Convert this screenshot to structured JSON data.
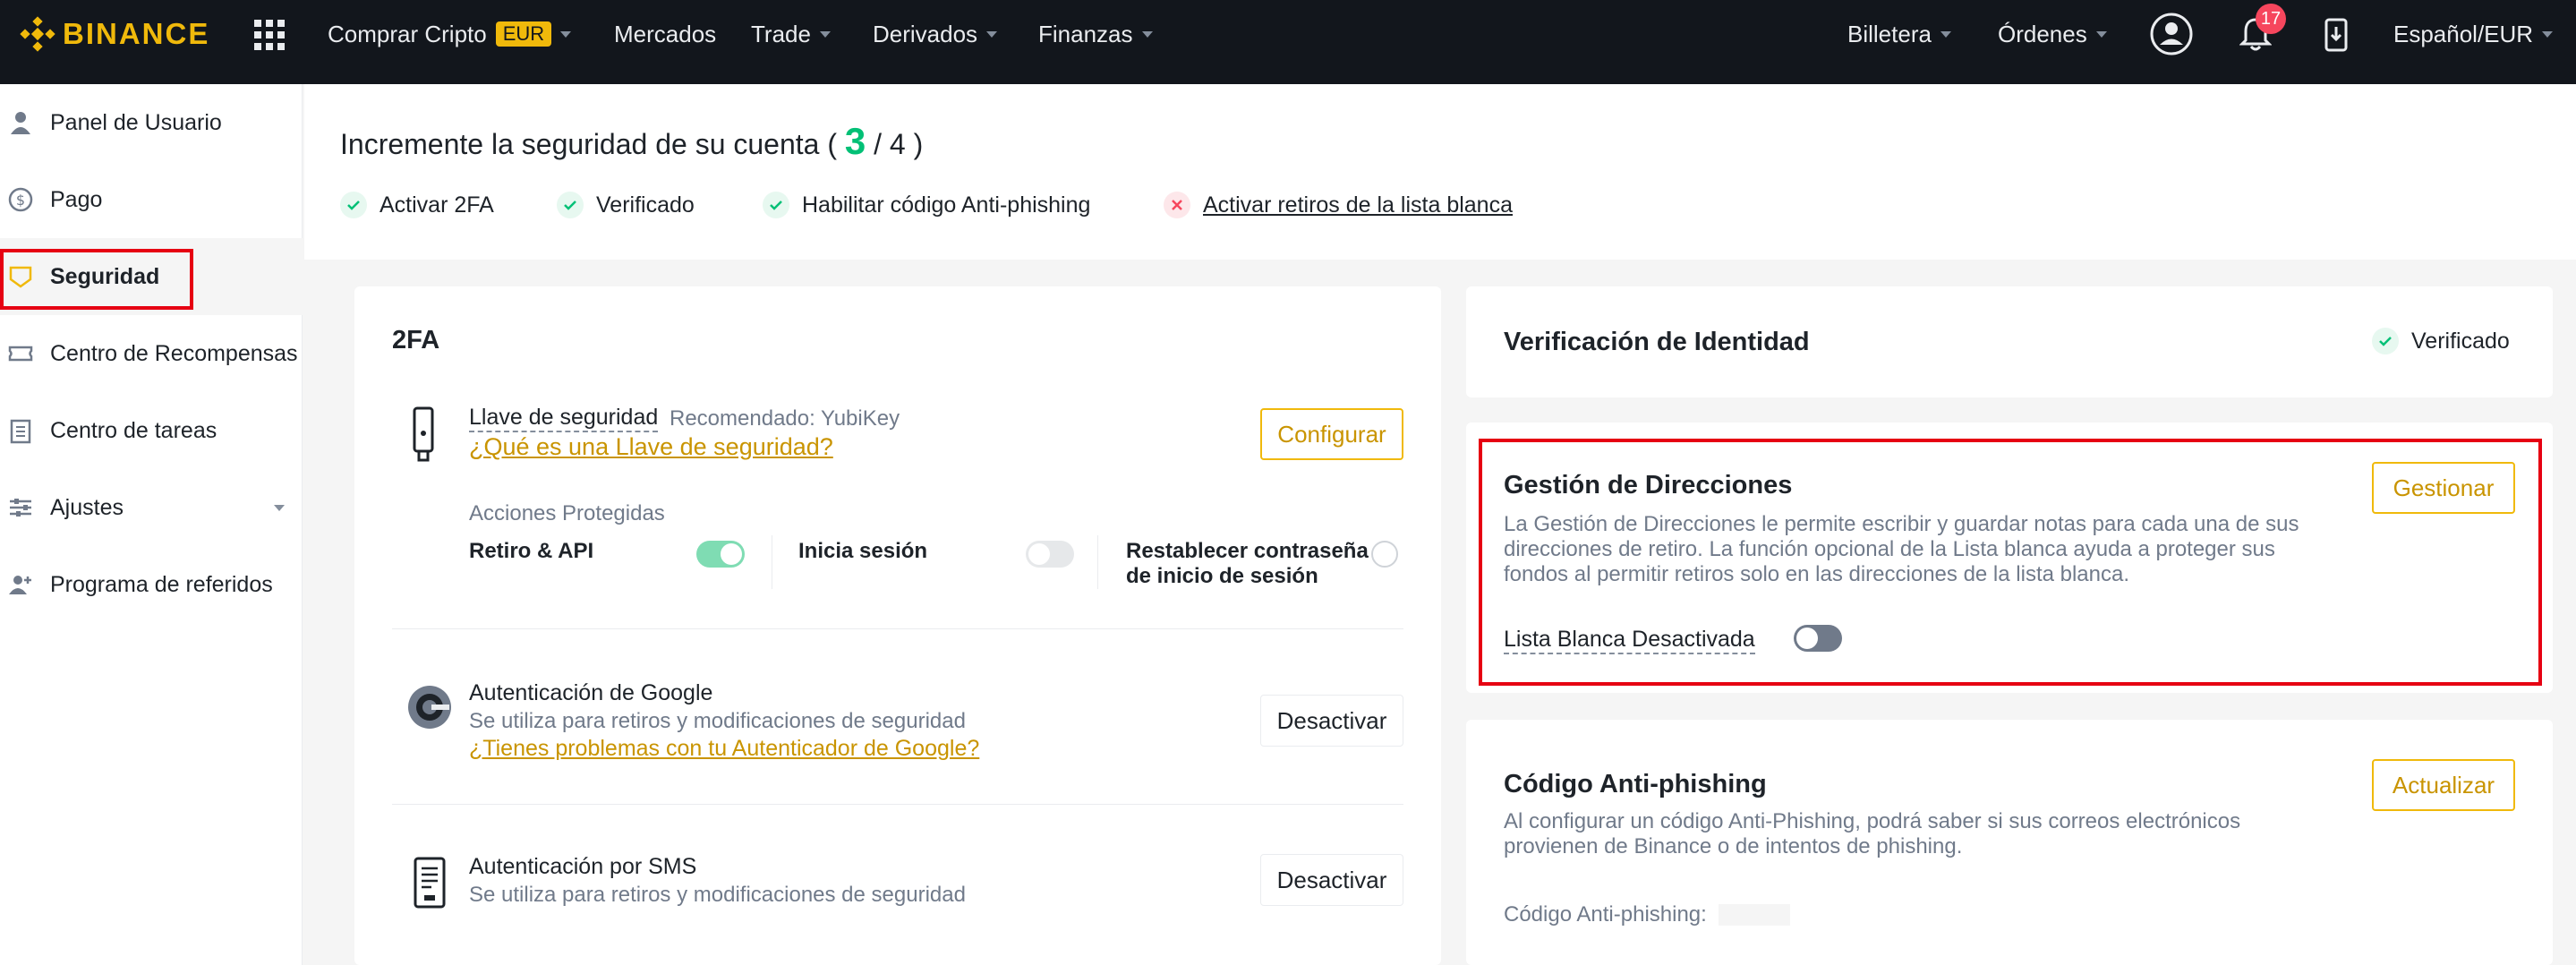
{
  "brand": {
    "name": "BINANCE",
    "color": "#f0b90b"
  },
  "topnav": {
    "items": [
      {
        "label": "Comprar Cripto",
        "badge": "EUR"
      },
      {
        "label": "Mercados"
      },
      {
        "label": "Trade"
      },
      {
        "label": "Derivados"
      },
      {
        "label": "Finanzas"
      }
    ],
    "right": {
      "wallet": "Billetera",
      "orders": "Órdenes",
      "notifications_count": "17",
      "language": "Español/EUR"
    }
  },
  "sidebar": {
    "items": [
      {
        "label": "Panel de Usuario",
        "icon": "user-icon"
      },
      {
        "label": "Pago",
        "icon": "dollar-icon"
      },
      {
        "label": "Seguridad",
        "icon": "shield-icon",
        "active": true
      },
      {
        "label": "Centro de Recompensas",
        "icon": "ticket-icon"
      },
      {
        "label": "Centro de tareas",
        "icon": "clipboard-icon"
      },
      {
        "label": "Ajustes",
        "icon": "sliders-icon"
      },
      {
        "label": "Programa de referidos",
        "icon": "user-add-icon"
      }
    ]
  },
  "summary": {
    "title_prefix": "Incremente la seguridad de su cuenta (",
    "score": "3",
    "score_total": "/ 4 )",
    "checks": [
      {
        "label": "Activar 2FA",
        "done": true
      },
      {
        "label": "Verificado",
        "done": true
      },
      {
        "label": "Habilitar código Anti-phishing",
        "done": true
      },
      {
        "label": "Activar retiros de la lista blanca",
        "done": false
      }
    ]
  },
  "twofa": {
    "title": "2FA",
    "security_key": {
      "title": "Llave de seguridad",
      "recommended": "Recomendado: YubiKey",
      "link": "¿Qué es una Llave de seguridad?",
      "button": "Configurar",
      "protected_actions_label": "Acciones Protegidas",
      "actions": [
        {
          "label": "Retiro & API",
          "on": true
        },
        {
          "label": "Inicia sesión",
          "on": false
        },
        {
          "label_line1": "Restablecer contraseña",
          "label_line2": "de inicio de sesión",
          "on": false
        }
      ]
    },
    "google": {
      "title": "Autenticación de Google",
      "desc": "Se utiliza para retiros y modificaciones de seguridad",
      "link": "¿Tienes problemas con tu Autenticador de Google?",
      "button": "Desactivar"
    },
    "sms": {
      "title": "Autenticación por SMS",
      "desc": "Se utiliza para retiros y modificaciones de seguridad",
      "button": "Desactivar"
    }
  },
  "identity": {
    "title": "Verificación de Identidad",
    "status": "Verificado"
  },
  "address": {
    "title": "Gestión de Direcciones",
    "desc_line1": "La Gestión de Direcciones le permite escribir y guardar notas para cada una de sus",
    "desc_line2": "direcciones de retiro. La función opcional de la Lista blanca ayuda a proteger sus",
    "desc_line3": "fondos al permitir retiros solo en las direcciones de la lista blanca.",
    "button": "Gestionar",
    "whitelist_label": "Lista Blanca Desactivada",
    "whitelist_on": false
  },
  "antiphishing": {
    "title": "Código Anti-phishing",
    "desc_line1": "Al configurar un código Anti-Phishing, podrá saber si sus correos electrónicos",
    "desc_line2": "provienen de Binance o de intentos de phishing.",
    "button": "Actualizar",
    "code_label": "Código Anti-phishing:"
  },
  "colors": {
    "accent": "#f0b90b",
    "success": "#02c076",
    "error": "#f6465d",
    "highlight_box": "#e60012"
  }
}
